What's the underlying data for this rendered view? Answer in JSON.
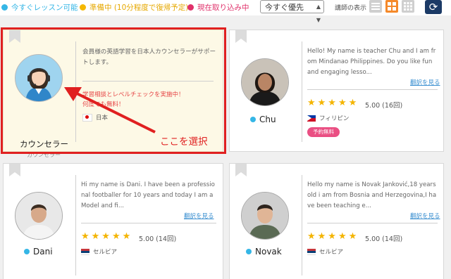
{
  "status": {
    "available_now": "今すぐレッスン可能",
    "preparing": "準備中 (10分程度で復帰予定)",
    "in_booking": "現在取り込み中",
    "colors": {
      "available_now": "#35b6e6",
      "preparing": "#f5b800",
      "in_booking": "#e0306a"
    }
  },
  "toolbar": {
    "sort_value": "今すぐ優先",
    "display_label": "講師の表示",
    "view_buttons": [
      "list-view",
      "grid-view",
      "tile-view"
    ],
    "active_view": "grid-view"
  },
  "counselor_card": {
    "name": "カウンセラー",
    "subtitle": "カウンセラー",
    "intro": "会員様の英語学習を日本人カウンセラーがサポートします。",
    "promo_line1": "学習相談とレベルチェックを実施中！",
    "promo_line2": "何度でも無料！",
    "country": "日本"
  },
  "annotation": {
    "callout": "ここを選択",
    "color": "#e02020"
  },
  "teachers": [
    {
      "name": "Chu",
      "intro": "Hello! My name is teacher Chu and I am from Mindanao Philippines. Do you like fun and engaging lesso...",
      "translate": "翻訳を見る",
      "stars": "★★★★★",
      "rating": "5.00 (16回)",
      "country": "フィリピン",
      "badge": "予約無料"
    },
    {
      "name": "Dani",
      "intro": "Hi my name is Dani. I have been a professional footballer for 10 years and today I am a Model and fi...",
      "translate": "翻訳を見る",
      "stars": "★★★★★",
      "rating": "5.00 (14回)",
      "country": "セルビア"
    },
    {
      "name": "Novak",
      "intro": "Hello my name is Novak Janković,18 years old i am from Bosnia and Herzegovina,I have been teaching e...",
      "translate": "翻訳を見る",
      "stars": "★★★★★",
      "rating": "5.00 (14回)",
      "country": "セルビア"
    }
  ]
}
